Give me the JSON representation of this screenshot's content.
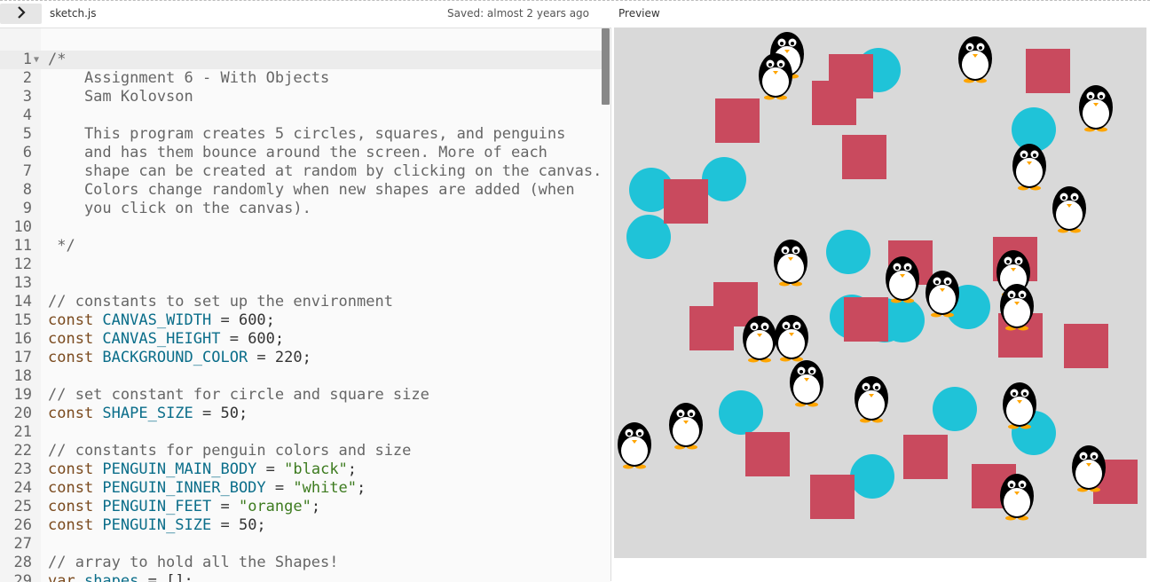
{
  "toolbar": {
    "toggle_icon": "chevron-right-icon",
    "filename": "sketch.js",
    "saved_status": "Saved: almost 2 years ago",
    "preview_label": "Preview"
  },
  "editor": {
    "lines": [
      {
        "n": "1",
        "fold": true,
        "tokens": [
          {
            "t": "/*",
            "c": "comment"
          }
        ]
      },
      {
        "n": "2",
        "tokens": [
          {
            "t": "    Assignment 6 - With Objects",
            "c": "comment"
          }
        ]
      },
      {
        "n": "3",
        "tokens": [
          {
            "t": "    Sam Kolovson",
            "c": "comment"
          }
        ]
      },
      {
        "n": "4",
        "tokens": []
      },
      {
        "n": "5",
        "tokens": [
          {
            "t": "    This program creates 5 circles, squares, and penguins",
            "c": "comment"
          }
        ]
      },
      {
        "n": "6",
        "tokens": [
          {
            "t": "    and has them bounce around the screen. More of each",
            "c": "comment"
          }
        ]
      },
      {
        "n": "7",
        "tokens": [
          {
            "t": "    shape can be created at random by clicking on the canvas.",
            "c": "comment"
          }
        ]
      },
      {
        "n": "8",
        "tokens": [
          {
            "t": "    Colors change randomly when new shapes are added (when",
            "c": "comment"
          }
        ]
      },
      {
        "n": "9",
        "tokens": [
          {
            "t": "    you click on the canvas).",
            "c": "comment"
          }
        ]
      },
      {
        "n": "10",
        "tokens": []
      },
      {
        "n": "11",
        "tokens": [
          {
            "t": " */",
            "c": "comment"
          }
        ]
      },
      {
        "n": "12",
        "tokens": []
      },
      {
        "n": "13",
        "tokens": []
      },
      {
        "n": "14",
        "tokens": [
          {
            "t": "// constants to set up the environment",
            "c": "comment"
          }
        ]
      },
      {
        "n": "15",
        "tokens": [
          {
            "t": "const ",
            "c": "kw"
          },
          {
            "t": "CANVAS_WIDTH",
            "c": "var"
          },
          {
            "t": " = 600;",
            "c": "plain"
          }
        ]
      },
      {
        "n": "16",
        "tokens": [
          {
            "t": "const ",
            "c": "kw"
          },
          {
            "t": "CANVAS_HEIGHT",
            "c": "var"
          },
          {
            "t": " = 600;",
            "c": "plain"
          }
        ]
      },
      {
        "n": "17",
        "tokens": [
          {
            "t": "const ",
            "c": "kw"
          },
          {
            "t": "BACKGROUND_COLOR",
            "c": "var"
          },
          {
            "t": " = 220;",
            "c": "plain"
          }
        ]
      },
      {
        "n": "18",
        "tokens": []
      },
      {
        "n": "19",
        "tokens": [
          {
            "t": "// set constant for circle and square size",
            "c": "comment"
          }
        ]
      },
      {
        "n": "20",
        "tokens": [
          {
            "t": "const ",
            "c": "kw"
          },
          {
            "t": "SHAPE_SIZE",
            "c": "var"
          },
          {
            "t": " = 50;",
            "c": "plain"
          }
        ]
      },
      {
        "n": "21",
        "tokens": []
      },
      {
        "n": "22",
        "tokens": [
          {
            "t": "// constants for penguin colors and size",
            "c": "comment"
          }
        ]
      },
      {
        "n": "23",
        "tokens": [
          {
            "t": "const ",
            "c": "kw"
          },
          {
            "t": "PENGUIN_MAIN_BODY",
            "c": "var"
          },
          {
            "t": " = ",
            "c": "plain"
          },
          {
            "t": "\"black\"",
            "c": "str"
          },
          {
            "t": ";",
            "c": "plain"
          }
        ]
      },
      {
        "n": "24",
        "tokens": [
          {
            "t": "const ",
            "c": "kw"
          },
          {
            "t": "PENGUIN_INNER_BODY",
            "c": "var"
          },
          {
            "t": " = ",
            "c": "plain"
          },
          {
            "t": "\"white\"",
            "c": "str"
          },
          {
            "t": ";",
            "c": "plain"
          }
        ]
      },
      {
        "n": "25",
        "tokens": [
          {
            "t": "const ",
            "c": "kw"
          },
          {
            "t": "PENGUIN_FEET",
            "c": "var"
          },
          {
            "t": " = ",
            "c": "plain"
          },
          {
            "t": "\"orange\"",
            "c": "str"
          },
          {
            "t": ";",
            "c": "plain"
          }
        ]
      },
      {
        "n": "26",
        "tokens": [
          {
            "t": "const ",
            "c": "kw"
          },
          {
            "t": "PENGUIN_SIZE",
            "c": "var"
          },
          {
            "t": " = 50;",
            "c": "plain"
          }
        ]
      },
      {
        "n": "27",
        "tokens": []
      },
      {
        "n": "28",
        "tokens": [
          {
            "t": "// array to hold all the Shapes!",
            "c": "comment"
          }
        ]
      },
      {
        "n": "29",
        "tokens": [
          {
            "t": "var ",
            "c": "kw"
          },
          {
            "t": "shapes",
            "c": "var"
          },
          {
            "t": " = [];",
            "c": "plain"
          }
        ]
      }
    ]
  },
  "preview": {
    "colors": {
      "background": "#d9d9d9",
      "circle": "#1fc3d8",
      "square": "#c94a5e",
      "penguin_body": "black",
      "penguin_inner": "white",
      "penguin_feet": "orange"
    }
  }
}
